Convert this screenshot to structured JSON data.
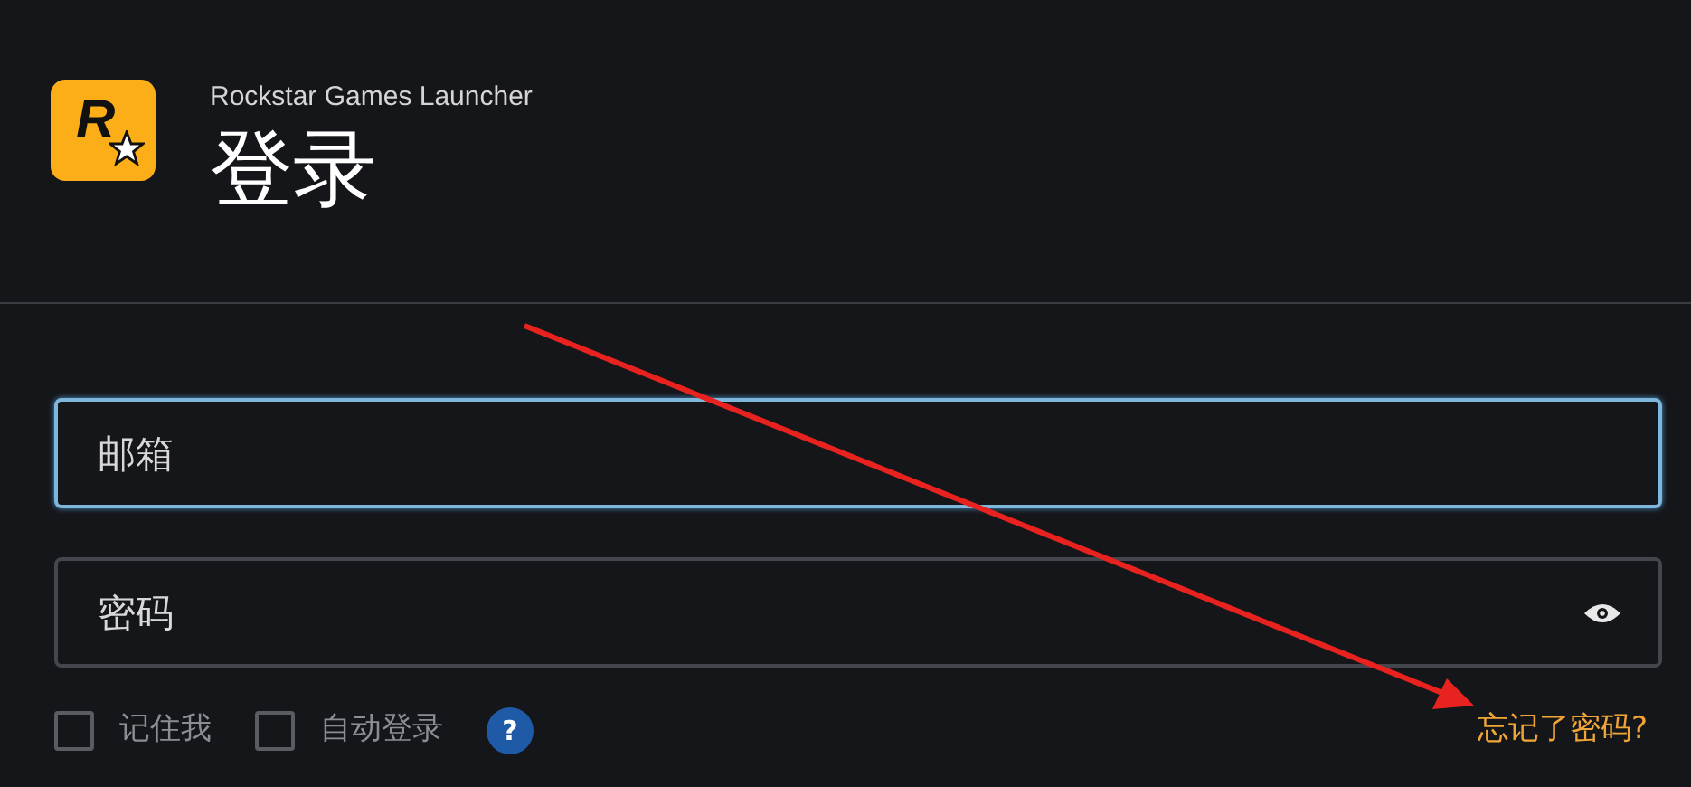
{
  "header": {
    "logo_letter": "R",
    "app_name": "Rockstar Games Launcher",
    "title": "登录"
  },
  "fields": [
    {
      "kind": "email",
      "placeholder": "邮箱",
      "focused": true
    },
    {
      "kind": "password",
      "placeholder": "密码",
      "focused": false
    }
  ],
  "options": [
    {
      "label": "记住我",
      "checked": false
    },
    {
      "label": "自动登录",
      "checked": false
    }
  ],
  "help": "?",
  "forgot_link": "忘记了密码?",
  "annotation": {
    "kind": "arrow"
  }
}
